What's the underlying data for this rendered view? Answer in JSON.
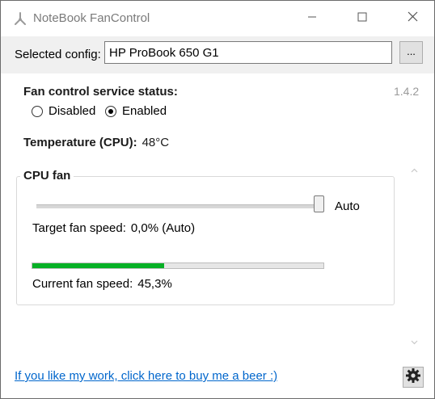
{
  "window": {
    "title": "NoteBook FanControl",
    "icons": {
      "app": "fan-icon",
      "minimize": "minimize-icon",
      "maximize": "maximize-icon",
      "close": "close-icon"
    }
  },
  "config": {
    "label": "Selected config:",
    "value": "HP ProBook 650 G1",
    "browse_label": "..."
  },
  "service": {
    "title": "Fan control service status:",
    "options": [
      {
        "label": "Disabled",
        "checked": false
      },
      {
        "label": "Enabled",
        "checked": true
      }
    ],
    "version": "1.4.2"
  },
  "temperature": {
    "label": "Temperature (CPU):",
    "value": "48°C"
  },
  "fan": {
    "title": "CPU fan",
    "slider_label": "Auto",
    "slider_position": 1.0,
    "target_label": "Target fan speed:",
    "target_value": "0,0% (Auto)",
    "current_label": "Current fan speed:",
    "current_value": "45,3%",
    "current_fraction": 0.453,
    "progress_color": "#06b025"
  },
  "footer": {
    "link_text": "If you like my work, click here to buy me a beer :)",
    "settings_icon": "gear-icon"
  }
}
